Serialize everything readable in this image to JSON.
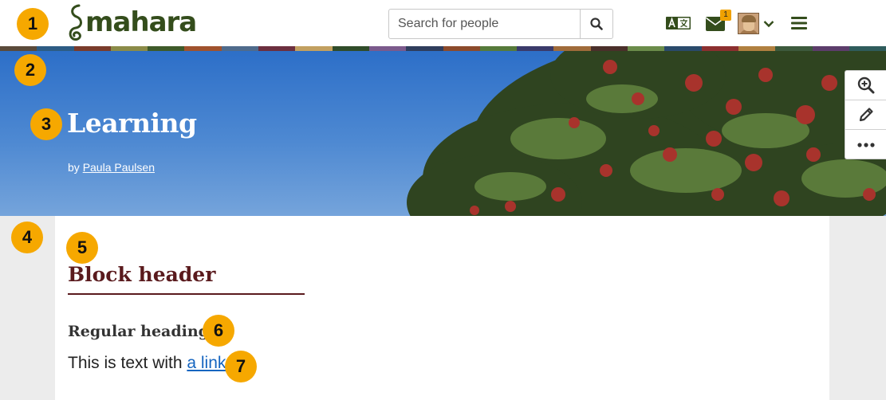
{
  "header": {
    "logo_text": "mahara",
    "search_placeholder": "Search for people",
    "search_button_icon": "search-icon",
    "language_icon": "language-icon",
    "inbox_icon": "envelope-icon",
    "inbox_count": "1",
    "user_menu_icon": "chevron-down-icon",
    "main_menu_icon": "hamburger-icon"
  },
  "banner": {
    "title": "Learning",
    "byline_prefix": "by ",
    "author": "Paula Paulsen"
  },
  "side_tools": [
    {
      "icon": "zoom-in-icon"
    },
    {
      "icon": "pencil-icon"
    },
    {
      "icon": "more-icon"
    }
  ],
  "content": {
    "block_header": "Block header",
    "regular_heading": "Regular heading",
    "text_before": "This is text with ",
    "link_text": "a link",
    "text_after": "."
  },
  "callouts": [
    "1",
    "2",
    "3",
    "4",
    "5",
    "6",
    "7"
  ],
  "colors": {
    "brand_green": "#344d1c",
    "block_header": "#5a1a1d",
    "link": "#1565c0",
    "callout": "#f6a800",
    "badge": "#f0a100"
  }
}
